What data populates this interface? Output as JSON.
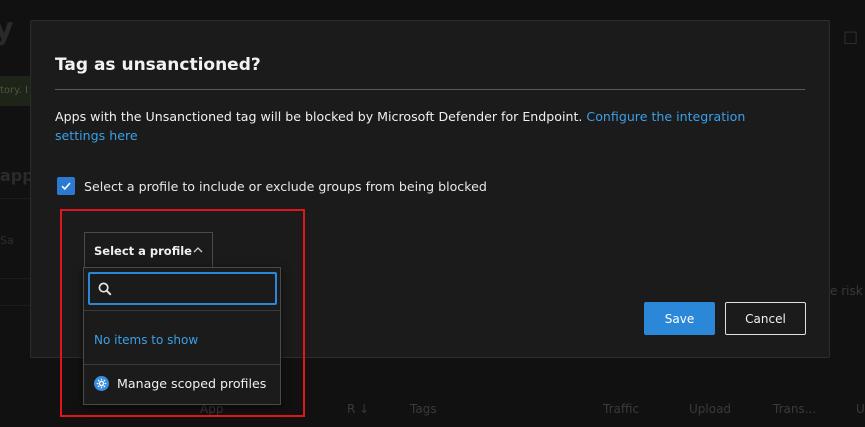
{
  "background": {
    "title_fragment": "y",
    "banner_fragment": "tory. I",
    "apps_fragment": "apps",
    "sa_fragment": "Sa",
    "close_glyph": "□",
    "risk_fragment": "e risk",
    "table_headers": [
      "App",
      "R ↓",
      "Tags",
      "Traffic",
      "Upload",
      "Trans...",
      "U"
    ]
  },
  "dialog": {
    "title": "Tag as unsanctioned?",
    "description": "Apps with the Unsanctioned tag will be blocked by Microsoft Defender for Endpoint.",
    "link_text": "Configure the integration settings here",
    "checkbox_label": "Select a profile to include or exclude groups from being blocked",
    "checkbox_checked": true,
    "profile_button_label": "Select a profile",
    "save_label": "Save",
    "cancel_label": "Cancel"
  },
  "dropdown": {
    "search_placeholder": "",
    "empty_text": "No items to show",
    "manage_label": "Manage scoped profiles"
  },
  "colors": {
    "accent": "#2b88d8",
    "link": "#3aa0e8",
    "highlight": "#e0161e"
  }
}
